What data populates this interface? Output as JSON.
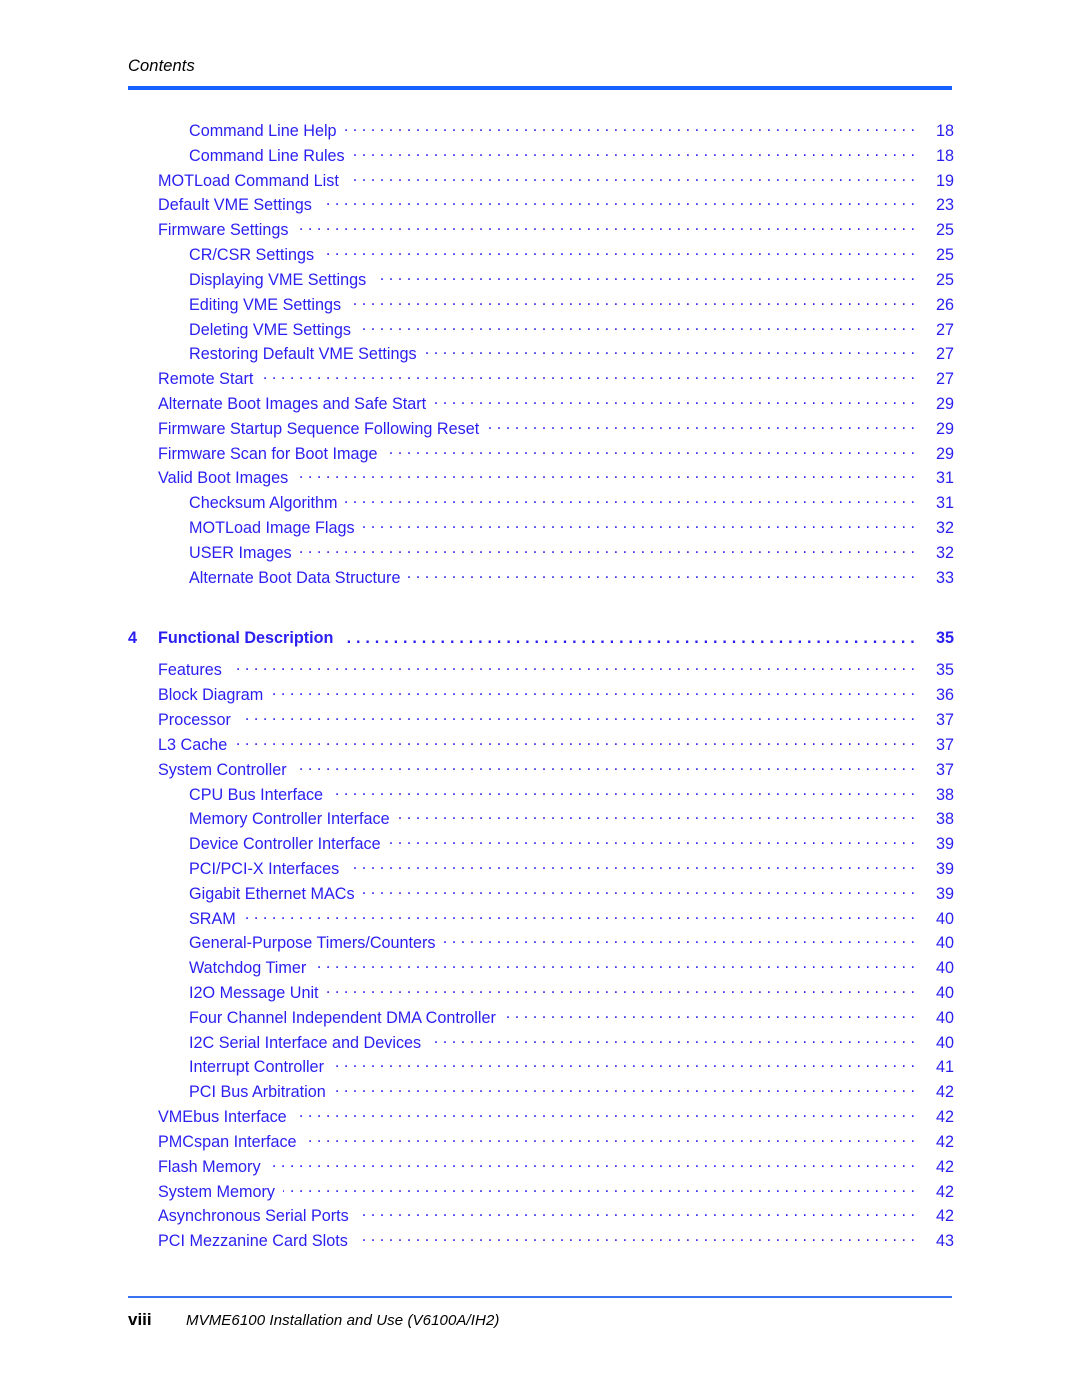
{
  "header": {
    "title": "Contents",
    "rule_color": "#1560ff"
  },
  "accent_color": "#2a1ff0",
  "toc": {
    "entries": [
      {
        "num": "",
        "label": "Command Line Help",
        "page": "18",
        "level": 2,
        "style": "normal"
      },
      {
        "num": "",
        "label": "Command Line Rules",
        "page": "18",
        "level": 2,
        "style": "normal"
      },
      {
        "num": "",
        "label": "MOTLoad Command List",
        "page": "19",
        "level": 1,
        "style": "normal"
      },
      {
        "num": "",
        "label": "Default VME Settings",
        "page": "23",
        "level": 1,
        "style": "normal"
      },
      {
        "num": "",
        "label": "Firmware Settings",
        "page": "25",
        "level": 1,
        "style": "normal"
      },
      {
        "num": "",
        "label": "CR/CSR Settings",
        "page": "25",
        "level": 2,
        "style": "normal"
      },
      {
        "num": "",
        "label": "Displaying VME Settings",
        "page": "25",
        "level": 2,
        "style": "normal"
      },
      {
        "num": "",
        "label": "Editing VME Settings",
        "page": "26",
        "level": 2,
        "style": "normal"
      },
      {
        "num": "",
        "label": "Deleting VME Settings",
        "page": "27",
        "level": 2,
        "style": "normal"
      },
      {
        "num": "",
        "label": "Restoring Default VME Settings",
        "page": "27",
        "level": 2,
        "style": "normal"
      },
      {
        "num": "",
        "label": "Remote Start",
        "page": "27",
        "level": 1,
        "style": "normal"
      },
      {
        "num": "",
        "label": "Alternate Boot Images and Safe Start",
        "page": "29",
        "level": 1,
        "style": "normal"
      },
      {
        "num": "",
        "label": "Firmware Startup Sequence Following Reset",
        "page": "29",
        "level": 1,
        "style": "normal"
      },
      {
        "num": "",
        "label": "Firmware Scan for Boot Image",
        "page": "29",
        "level": 1,
        "style": "normal"
      },
      {
        "num": "",
        "label": "Valid Boot Images",
        "page": "31",
        "level": 1,
        "style": "normal"
      },
      {
        "num": "",
        "label": "Checksum Algorithm",
        "page": "31",
        "level": 2,
        "style": "normal"
      },
      {
        "num": "",
        "label": "MOTLoad Image Flags",
        "page": "32",
        "level": 2,
        "style": "normal"
      },
      {
        "num": "",
        "label": "USER Images",
        "page": "32",
        "level": 2,
        "style": "normal"
      },
      {
        "num": "",
        "label": "Alternate Boot Data Structure",
        "page": "33",
        "level": 2,
        "style": "normal"
      },
      {
        "num": "4",
        "label": "Functional Description",
        "page": "35",
        "level": 1,
        "style": "chapter"
      },
      {
        "num": "",
        "label": "Features",
        "page": "35",
        "level": 1,
        "style": "normal"
      },
      {
        "num": "",
        "label": "Block Diagram",
        "page": "36",
        "level": 1,
        "style": "normal"
      },
      {
        "num": "",
        "label": "Processor",
        "page": "37",
        "level": 1,
        "style": "normal"
      },
      {
        "num": "",
        "label": "L3 Cache",
        "page": "37",
        "level": 1,
        "style": "normal"
      },
      {
        "num": "",
        "label": "System Controller",
        "page": "37",
        "level": 1,
        "style": "normal"
      },
      {
        "num": "",
        "label": "CPU Bus Interface",
        "page": "38",
        "level": 2,
        "style": "normal"
      },
      {
        "num": "",
        "label": "Memory Controller Interface",
        "page": "38",
        "level": 2,
        "style": "normal"
      },
      {
        "num": "",
        "label": "Device Controller Interface",
        "page": "39",
        "level": 2,
        "style": "normal"
      },
      {
        "num": "",
        "label": "PCI/PCI-X Interfaces",
        "page": "39",
        "level": 2,
        "style": "normal"
      },
      {
        "num": "",
        "label": "Gigabit Ethernet MACs",
        "page": "39",
        "level": 2,
        "style": "normal"
      },
      {
        "num": "",
        "label": "SRAM",
        "page": "40",
        "level": 2,
        "style": "normal"
      },
      {
        "num": "",
        "label": "General-Purpose Timers/Counters",
        "page": "40",
        "level": 2,
        "style": "normal"
      },
      {
        "num": "",
        "label": "Watchdog Timer",
        "page": "40",
        "level": 2,
        "style": "normal"
      },
      {
        "num": "",
        "label": "I2O Message Unit",
        "page": "40",
        "level": 2,
        "style": "normal"
      },
      {
        "num": "",
        "label": "Four Channel Independent DMA Controller",
        "page": "40",
        "level": 2,
        "style": "normal"
      },
      {
        "num": "",
        "label": "I2C Serial Interface and Devices",
        "page": "40",
        "level": 2,
        "style": "normal"
      },
      {
        "num": "",
        "label": "Interrupt Controller",
        "page": "41",
        "level": 2,
        "style": "normal"
      },
      {
        "num": "",
        "label": "PCI Bus Arbitration",
        "page": "42",
        "level": 2,
        "style": "normal"
      },
      {
        "num": "",
        "label": "VMEbus Interface",
        "page": "42",
        "level": 1,
        "style": "normal"
      },
      {
        "num": "",
        "label": "PMCspan Interface",
        "page": "42",
        "level": 1,
        "style": "normal"
      },
      {
        "num": "",
        "label": "Flash Memory",
        "page": "42",
        "level": 1,
        "style": "normal"
      },
      {
        "num": "",
        "label": "System Memory",
        "page": "42",
        "level": 1,
        "style": "normal"
      },
      {
        "num": "",
        "label": "Asynchronous Serial Ports",
        "page": "42",
        "level": 1,
        "style": "normal"
      },
      {
        "num": "",
        "label": "PCI Mezzanine Card Slots",
        "page": "43",
        "level": 1,
        "style": "normal"
      }
    ]
  },
  "footer": {
    "page_number": "viii",
    "document_title": "MVME6100 Installation and Use (V6100A/IH2)",
    "rule_color": "#3a72f0"
  }
}
